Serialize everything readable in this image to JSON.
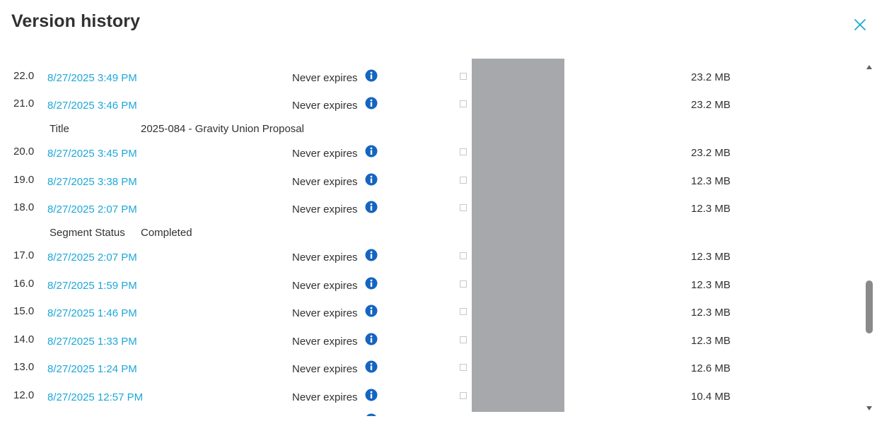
{
  "dialog": {
    "title": "Version history"
  },
  "icons": {
    "close": "close-icon",
    "info": "info-icon"
  },
  "colors": {
    "link": "#1ea7d8",
    "close": "#1ea7d8",
    "info": "#1565c0",
    "redaction": "#a7a8ab"
  },
  "versions": [
    {
      "number": "22.0",
      "date": "8/27/2025 3:49 PM",
      "expiration": "Never expires",
      "size": "23.2 MB"
    },
    {
      "number": "21.0",
      "date": "8/27/2025 3:46 PM",
      "expiration": "Never expires",
      "size": "23.2 MB"
    },
    {
      "number": "20.0",
      "date": "8/27/2025 3:45 PM",
      "expiration": "Never expires",
      "size": "23.2 MB"
    },
    {
      "number": "19.0",
      "date": "8/27/2025 3:38 PM",
      "expiration": "Never expires",
      "size": "12.3 MB"
    },
    {
      "number": "18.0",
      "date": "8/27/2025 2:07 PM",
      "expiration": "Never expires",
      "size": "12.3 MB"
    },
    {
      "number": "17.0",
      "date": "8/27/2025 2:07 PM",
      "expiration": "Never expires",
      "size": "12.3 MB"
    },
    {
      "number": "16.0",
      "date": "8/27/2025 1:59 PM",
      "expiration": "Never expires",
      "size": "12.3 MB"
    },
    {
      "number": "15.0",
      "date": "8/27/2025 1:46 PM",
      "expiration": "Never expires",
      "size": "12.3 MB"
    },
    {
      "number": "14.0",
      "date": "8/27/2025 1:33 PM",
      "expiration": "Never expires",
      "size": "12.3 MB"
    },
    {
      "number": "13.0",
      "date": "8/27/2025 1:24 PM",
      "expiration": "Never expires",
      "size": "12.6 MB"
    },
    {
      "number": "12.0",
      "date": "8/27/2025 12:57 PM",
      "expiration": "Never expires",
      "size": "10.4 MB"
    }
  ],
  "metadata_changes": [
    {
      "label": "Title",
      "value": "2025-084 - Gravity Union Proposal"
    },
    {
      "label": "Segment Status",
      "value": "Completed"
    }
  ]
}
